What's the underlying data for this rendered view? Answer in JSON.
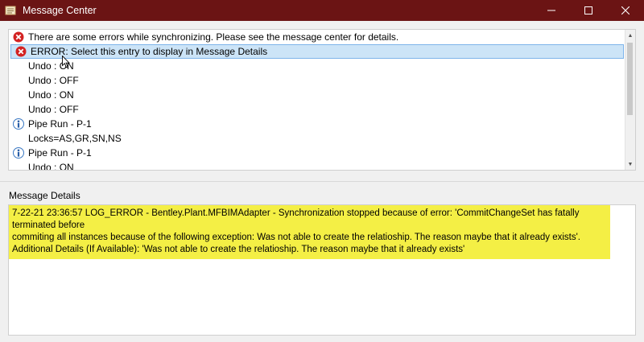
{
  "window": {
    "title": "Message Center",
    "minimize_icon": "minimize-icon",
    "maximize_icon": "maximize-icon",
    "close_icon": "close-icon",
    "title_color": "#6b1414"
  },
  "messages": [
    {
      "icon": "error-icon",
      "text": "There are some errors while synchronizing. Please see the message center for details."
    },
    {
      "icon": "error-icon",
      "text": "ERROR: Select this entry to display in Message Details",
      "selected": true
    },
    {
      "icon": "",
      "text": "Undo : ON"
    },
    {
      "icon": "",
      "text": "Undo : OFF"
    },
    {
      "icon": "",
      "text": "Undo : ON"
    },
    {
      "icon": "",
      "text": "Undo : OFF"
    },
    {
      "icon": "info-icon",
      "text": "Pipe Run - P-1"
    },
    {
      "icon": "",
      "text": "Locks=AS,GR,SN,NS"
    },
    {
      "icon": "info-icon",
      "text": "Pipe Run - P-1"
    },
    {
      "icon": "",
      "text": "Undo : ON"
    }
  ],
  "details": {
    "label": "Message Details",
    "line1": "7-22-21 23:36:57 LOG_ERROR - Bentley.Plant.MFBIMAdapter - Synchronization stopped because of error: 'CommitChangeSet has fatally terminated before",
    "line2": "commiting all instances because of the following exception: Was not able to create the relatioship. The reason maybe that it already exists'.",
    "line3": "Additional Details (If Available): 'Was not able to create the relatioship. The reason maybe that it already exists'",
    "highlight_color": "#f4ef45"
  }
}
